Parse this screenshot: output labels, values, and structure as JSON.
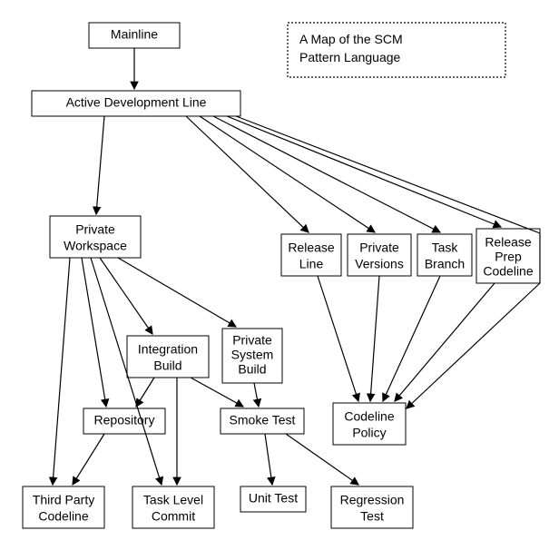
{
  "title": {
    "line1": "A Map of the SCM",
    "line2": "Pattern Language"
  },
  "nodes": {
    "mainline": "Mainline",
    "activeDev": "Active Development Line",
    "privateWorkspace": {
      "l1": "Private",
      "l2": "Workspace"
    },
    "releaseLine": {
      "l1": "Release",
      "l2": "Line"
    },
    "privateVersions": {
      "l1": "Private",
      "l2": "Versions"
    },
    "taskBranch": {
      "l1": "Task",
      "l2": "Branch"
    },
    "releasePrep": {
      "l1": "Release",
      "l2": "Prep",
      "l3": "Codeline"
    },
    "integrationBuild": {
      "l1": "Integration",
      "l2": "Build"
    },
    "privateSystemBuild": {
      "l1": "Private",
      "l2": "System",
      "l3": "Build"
    },
    "repository": "Repository",
    "smokeTest": "Smoke Test",
    "codelinePolicy": {
      "l1": "Codeline",
      "l2": "Policy"
    },
    "thirdParty": {
      "l1": "Third Party",
      "l2": "Codeline"
    },
    "taskLevelCommit": {
      "l1": "Task Level",
      "l2": "Commit"
    },
    "unitTest": "Unit Test",
    "regressionTest": {
      "l1": "Regression",
      "l2": "Test"
    }
  }
}
